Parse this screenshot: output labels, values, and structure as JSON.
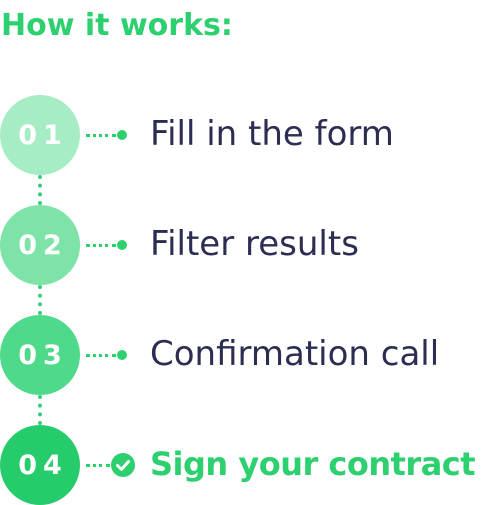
{
  "title": "How it works:",
  "colors": {
    "accent": "#2dd06e",
    "text_dark": "#2b2d52",
    "circle_1": "#a6ecc4",
    "circle_2": "#7de3a6",
    "circle_3": "#4fd98a",
    "circle_4": "#26cc6b"
  },
  "steps": [
    {
      "number": "01",
      "label": "Fill in the form",
      "marker": "dot"
    },
    {
      "number": "02",
      "label": "Filter results",
      "marker": "dot"
    },
    {
      "number": "03",
      "label": "Confirmation call",
      "marker": "dot"
    },
    {
      "number": "04",
      "label": "Sign your contract",
      "marker": "check-icon",
      "active": true
    }
  ]
}
